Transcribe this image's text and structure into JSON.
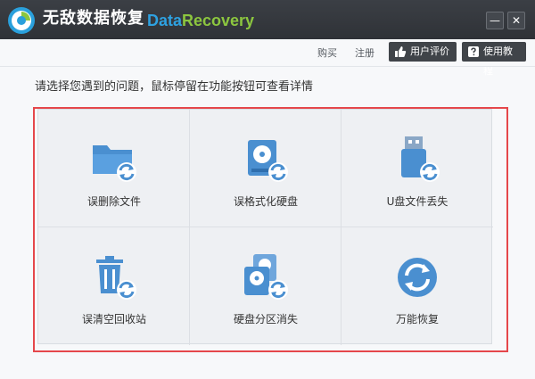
{
  "titlebar": {
    "app_title": "无敌数据恢复",
    "brand_part1": "Data",
    "brand_part2": "Recovery",
    "minimize_label": "—",
    "close_label": "✕"
  },
  "menu": {
    "buy": "购买",
    "register": "注册",
    "user_review": "用户评价",
    "tutorial": "使用教程"
  },
  "prompt": "请选择您遇到的问题，鼠标停留在功能按钮可查看详情",
  "options": [
    {
      "label": "误删除文件",
      "icon": "folder-recover-icon"
    },
    {
      "label": "误格式化硬盘",
      "icon": "disk-format-icon"
    },
    {
      "label": "U盘文件丢失",
      "icon": "usb-drive-icon"
    },
    {
      "label": "误清空回收站",
      "icon": "recycle-bin-icon"
    },
    {
      "label": "硬盘分区消失",
      "icon": "partition-icon"
    },
    {
      "label": "万能恢复",
      "icon": "universal-recover-icon"
    }
  ],
  "colors": {
    "icon_blue": "#4a8fd0",
    "highlight": "#e5474b",
    "brand_blue": "#2ea1e0",
    "brand_green": "#8cc63f"
  }
}
